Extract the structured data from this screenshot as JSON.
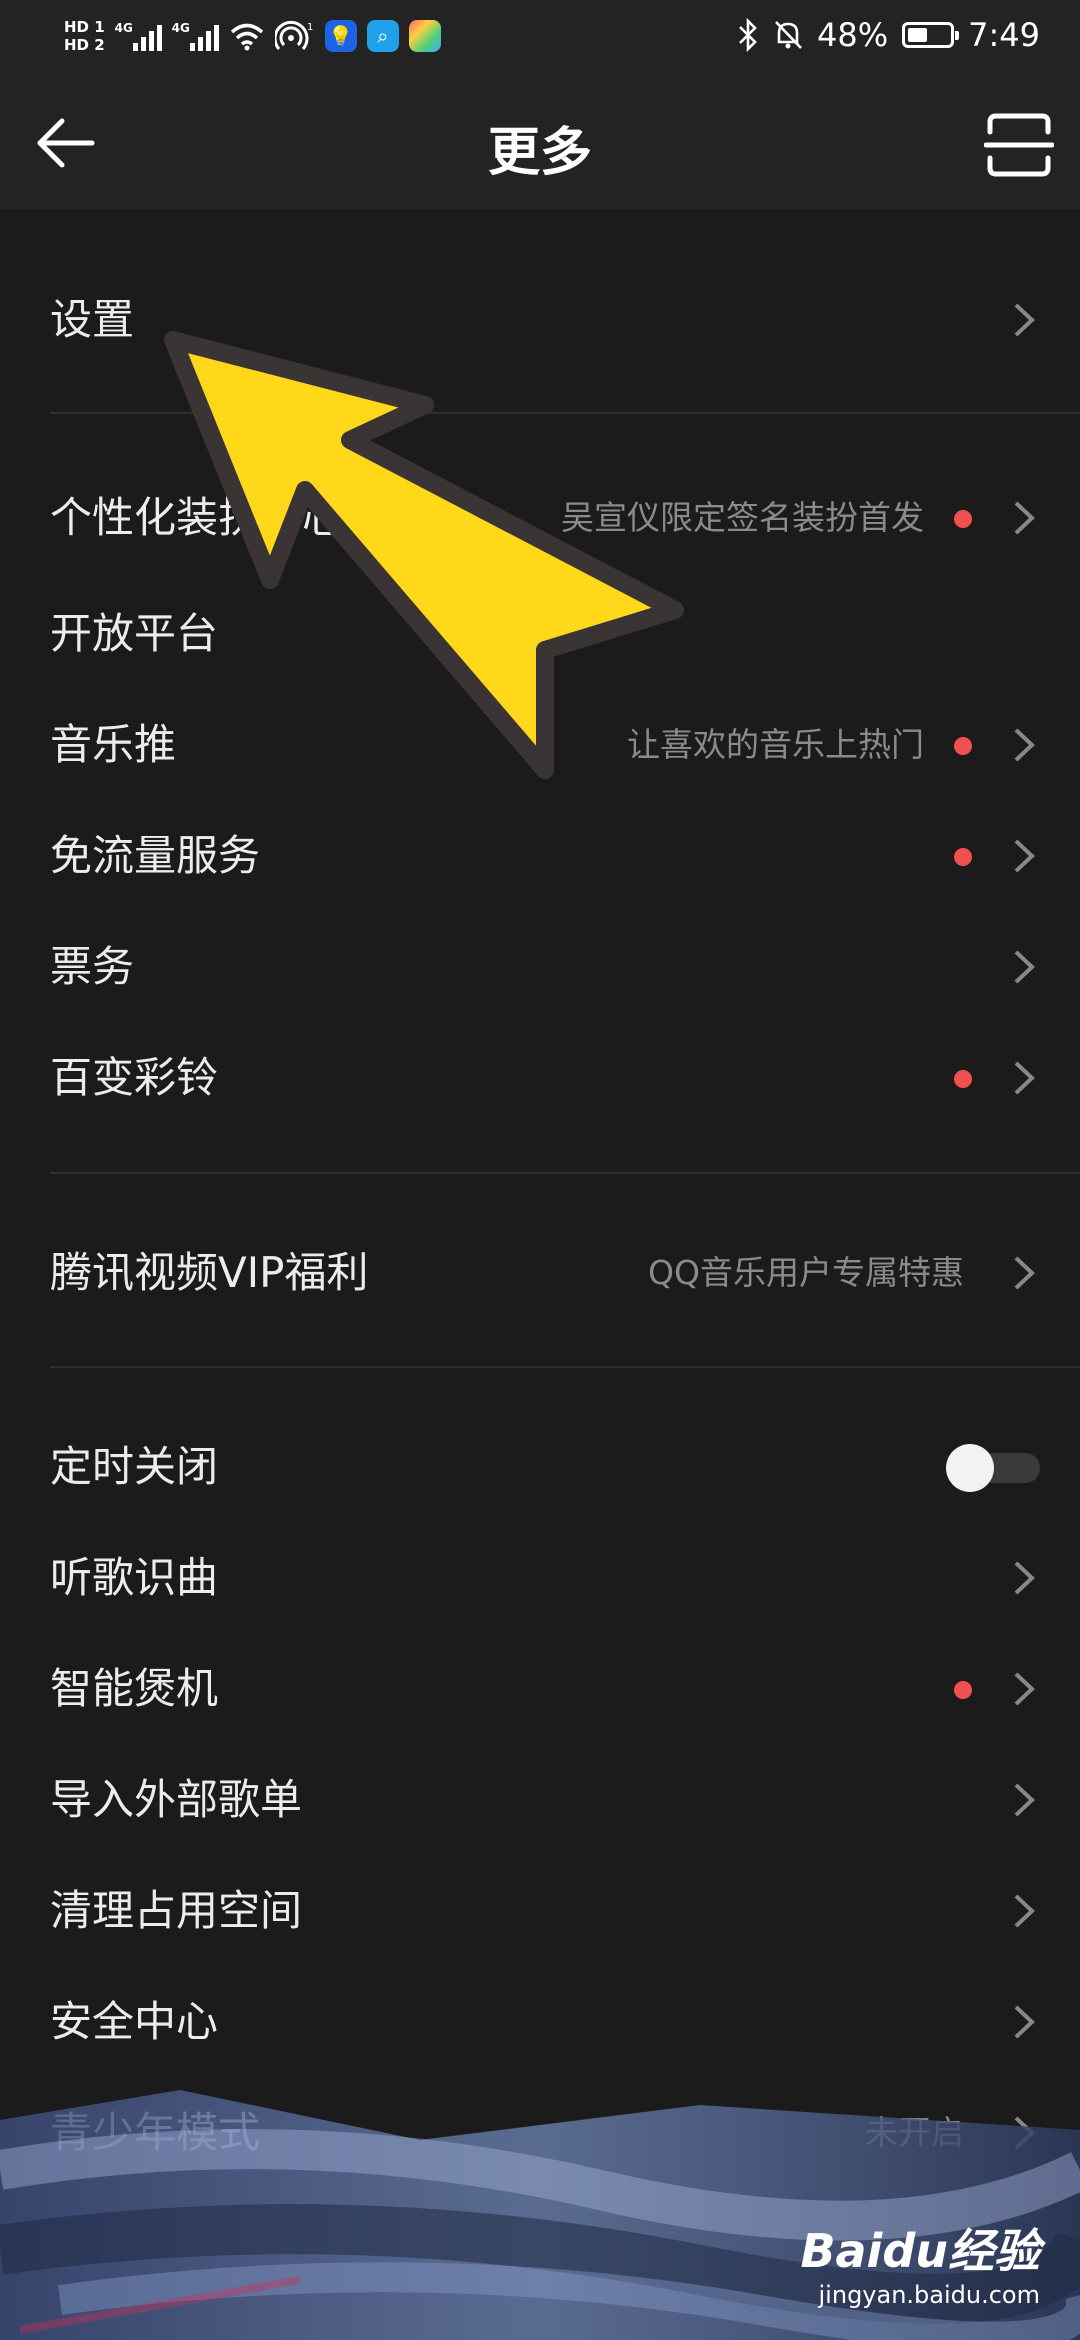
{
  "status_bar": {
    "hd1": "HD 1",
    "hd2": "HD 2",
    "net1": "4G",
    "net2": "4G",
    "battery_percent": "48%",
    "battery_level": 0.48,
    "time": "7:49"
  },
  "header": {
    "title": "更多",
    "back_icon": "arrow-left-icon",
    "scan_icon": "scan-icon"
  },
  "items": {
    "settings": {
      "label": "设置"
    },
    "personalize": {
      "label": "个性化装扮中心",
      "sub": "吴宣仪限定签名装扮首发",
      "dot": true
    },
    "open_platform": {
      "label": "开放平台"
    },
    "music_push": {
      "label": "音乐推",
      "sub": "让喜欢的音乐上热门",
      "dot": true
    },
    "free_traffic": {
      "label": "免流量服务",
      "dot": true
    },
    "tickets": {
      "label": "票务"
    },
    "ringtone": {
      "label": "百变彩铃",
      "dot": true
    },
    "tencent_video": {
      "label": "腾讯视频VIP福利",
      "sub": "QQ音乐用户专属特惠"
    },
    "sleep_timer": {
      "label": "定时关闭",
      "toggle_on": false
    },
    "song_recognition": {
      "label": "听歌识曲"
    },
    "smart_burn_in": {
      "label": "智能煲机",
      "dot": true
    },
    "import_playlist": {
      "label": "导入外部歌单"
    },
    "clean_space": {
      "label": "清理占用空间"
    },
    "security_center": {
      "label": "安全中心"
    },
    "teen_mode": {
      "label": "青少年模式",
      "sub": "未开启"
    }
  },
  "watermark": {
    "brand": "Baidu经验",
    "url": "jingyan.baidu.com"
  },
  "colors": {
    "background": "#1b1b1b",
    "header": "#232323",
    "red_dot": "#f0504f",
    "annotation_arrow": "#ffd81a"
  }
}
